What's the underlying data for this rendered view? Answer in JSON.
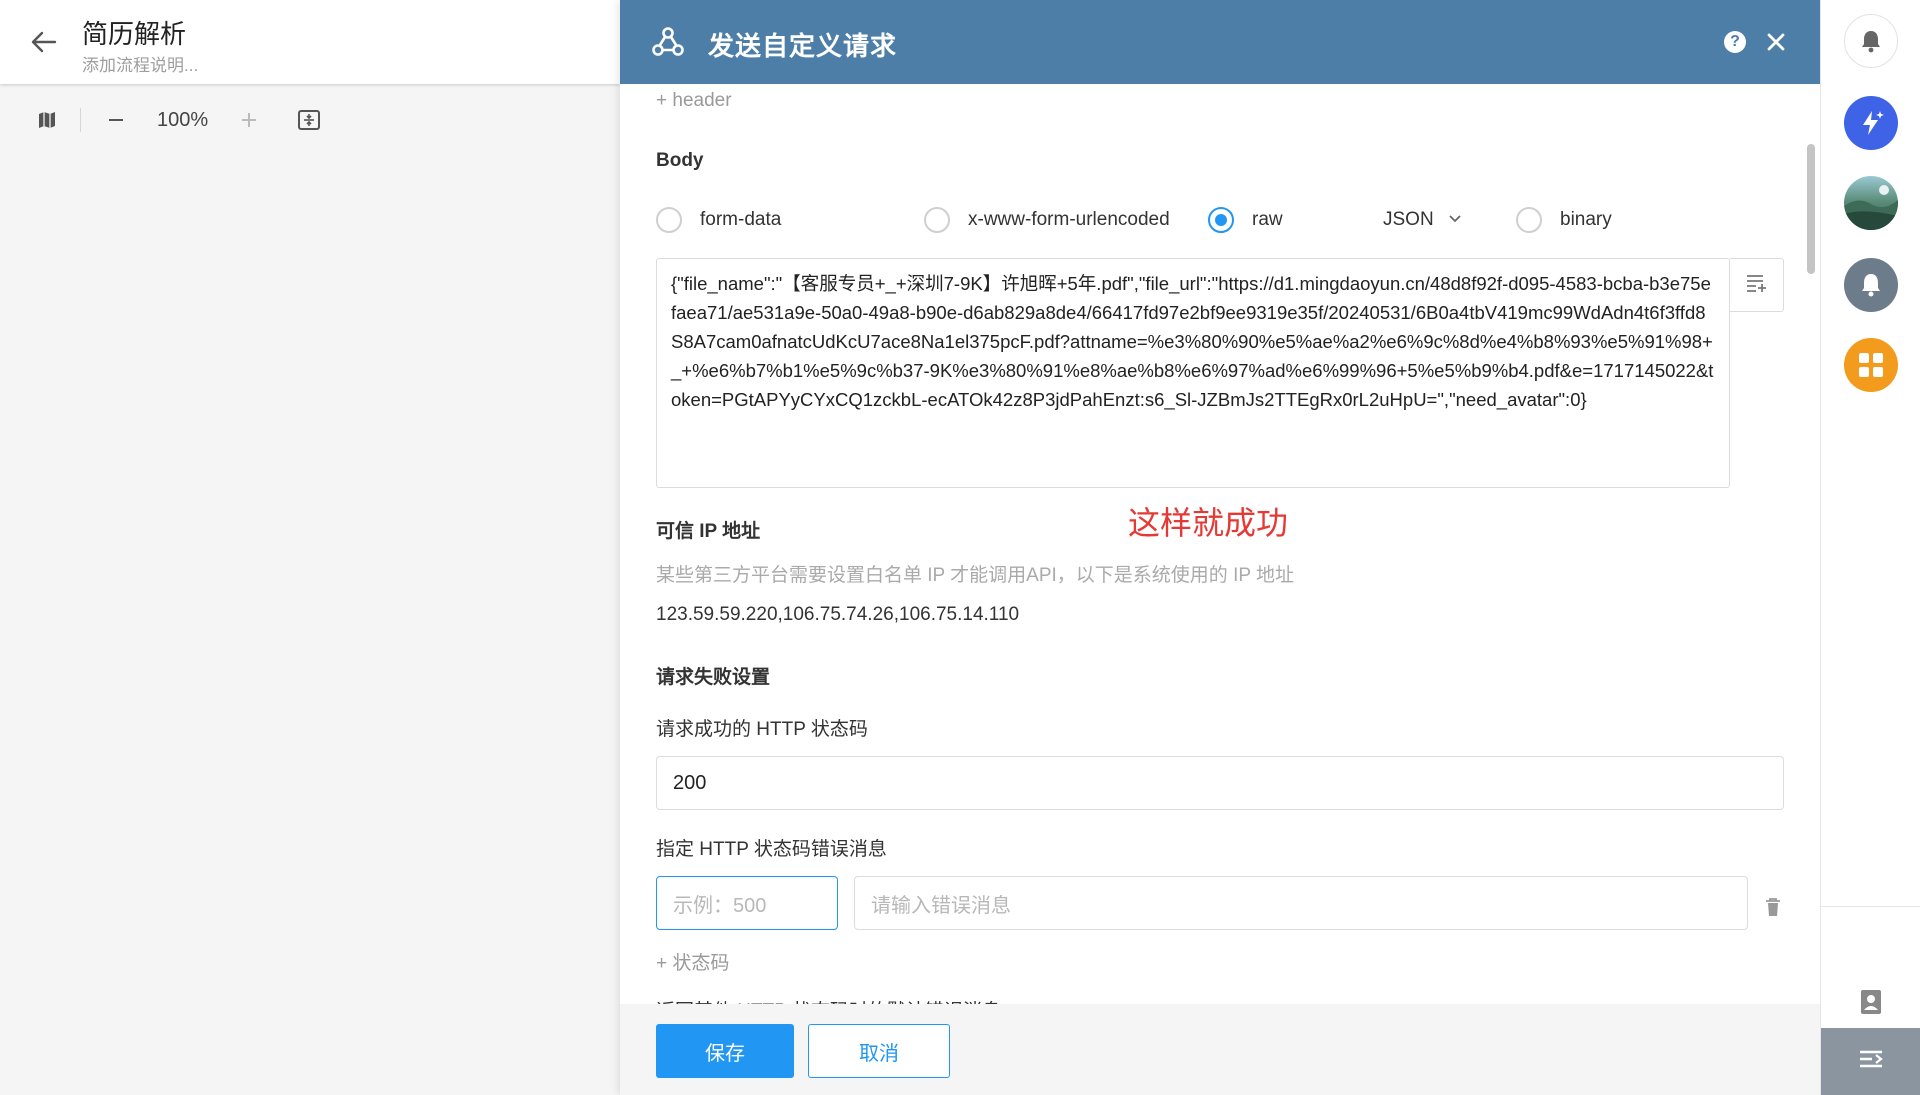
{
  "workflow": {
    "title": "简历解析",
    "description_placeholder": "添加流程说明...",
    "zoom": "100%"
  },
  "dialog": {
    "title": "发送自定义请求",
    "help_icon": "?",
    "add_header": "+ header",
    "body_label": "Body",
    "body_types": {
      "form_data": "form-data",
      "urlencoded": "x-www-form-urlencoded",
      "raw": "raw",
      "binary": "binary"
    },
    "selected_body_type": "raw",
    "raw_format": "JSON",
    "raw_content": "{\"file_name\":\"【客服专员+_+深圳7-9K】许旭晖+5年.pdf\",\"file_url\":\"https://d1.mingdaoyun.cn/48d8f92f-d095-4583-bcba-b3e75efaea71/ae531a9e-50a0-49a8-b90e-d6ab829a8de4/66417fd97e2bf9ee9319e35f/20240531/6B0a4tbV419mc99WdAdn4t6f3ffd8S8A7cam0afnatcUdKcU7ace8Na1el375pcF.pdf?attname=%e3%80%90%e5%ae%a2%e6%9c%8d%e4%b8%93%e5%91%98+_+%e6%b7%b1%e5%9c%b37-9K%e3%80%91%e8%ae%b8%e6%97%ad%e6%99%96+5%e5%b9%b4.pdf&e=1717145022&token=PGtAPYyCYxCQ1zckbL-ecATOk42z8P3jdPahEnzt:s6_Sl-JZBmJs2TTEgRx0rL2uHpU=\",\"need_avatar\":0}",
    "annotation": "这样就成功",
    "trusted_ip": {
      "label": "可信 IP 地址",
      "hint": "某些第三方平台需要设置白名单 IP 才能调用API，以下是系统使用的 IP 地址",
      "value": "123.59.59.220,106.75.74.26,106.75.14.110"
    },
    "failure": {
      "label": "请求失败设置",
      "success_code_label": "请求成功的 HTTP 状态码",
      "success_code_value": "200",
      "error_msg_label": "指定 HTTP 状态码错误消息",
      "status_placeholder": "示例：500",
      "message_placeholder": "请输入错误消息",
      "add_status": "+ 状态码",
      "truncated_text": "返回其他 HTTP 状态码时的默认错误消息"
    },
    "save_label": "保存",
    "cancel_label": "取消"
  },
  "colors": {
    "header_bg": "#4d7ea8",
    "primary": "#2196f3",
    "annotation": "#e53935"
  }
}
